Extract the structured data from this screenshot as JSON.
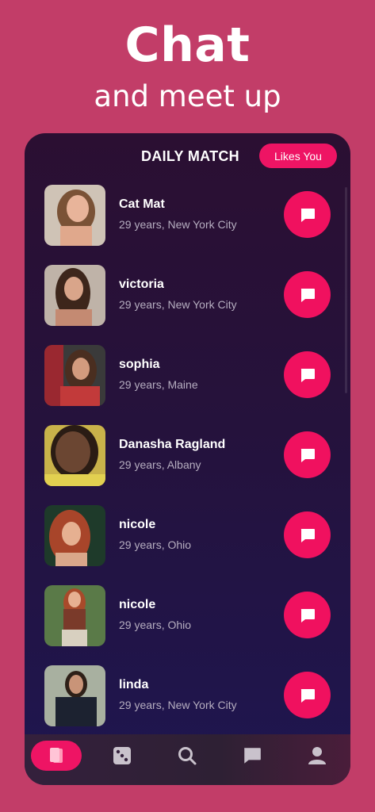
{
  "promo": {
    "headline": "Chat",
    "subheadline": "and meet up"
  },
  "header": {
    "title": "DAILY MATCH",
    "likes_button": "Likes You"
  },
  "matches": [
    {
      "name": "Cat Mat",
      "details": "29 years, New York City"
    },
    {
      "name": "victoria",
      "details": "29 years, New York City"
    },
    {
      "name": "sophia",
      "details": "29 years, Maine"
    },
    {
      "name": "Danasha Ragland",
      "details": "29 years, Albany"
    },
    {
      "name": "nicole",
      "details": "29 years, Ohio"
    },
    {
      "name": "nicole",
      "details": "29 years, Ohio"
    },
    {
      "name": "linda",
      "details": "29 years, New York City"
    }
  ],
  "nav": {
    "items": [
      {
        "icon": "cards-icon",
        "active": true
      },
      {
        "icon": "dice-icon",
        "active": false
      },
      {
        "icon": "search-icon",
        "active": false
      },
      {
        "icon": "chat-icon",
        "active": false
      },
      {
        "icon": "profile-icon",
        "active": false
      }
    ]
  },
  "colors": {
    "background": "#c23d68",
    "accent": "#ee1464",
    "panel": "#25123c"
  }
}
